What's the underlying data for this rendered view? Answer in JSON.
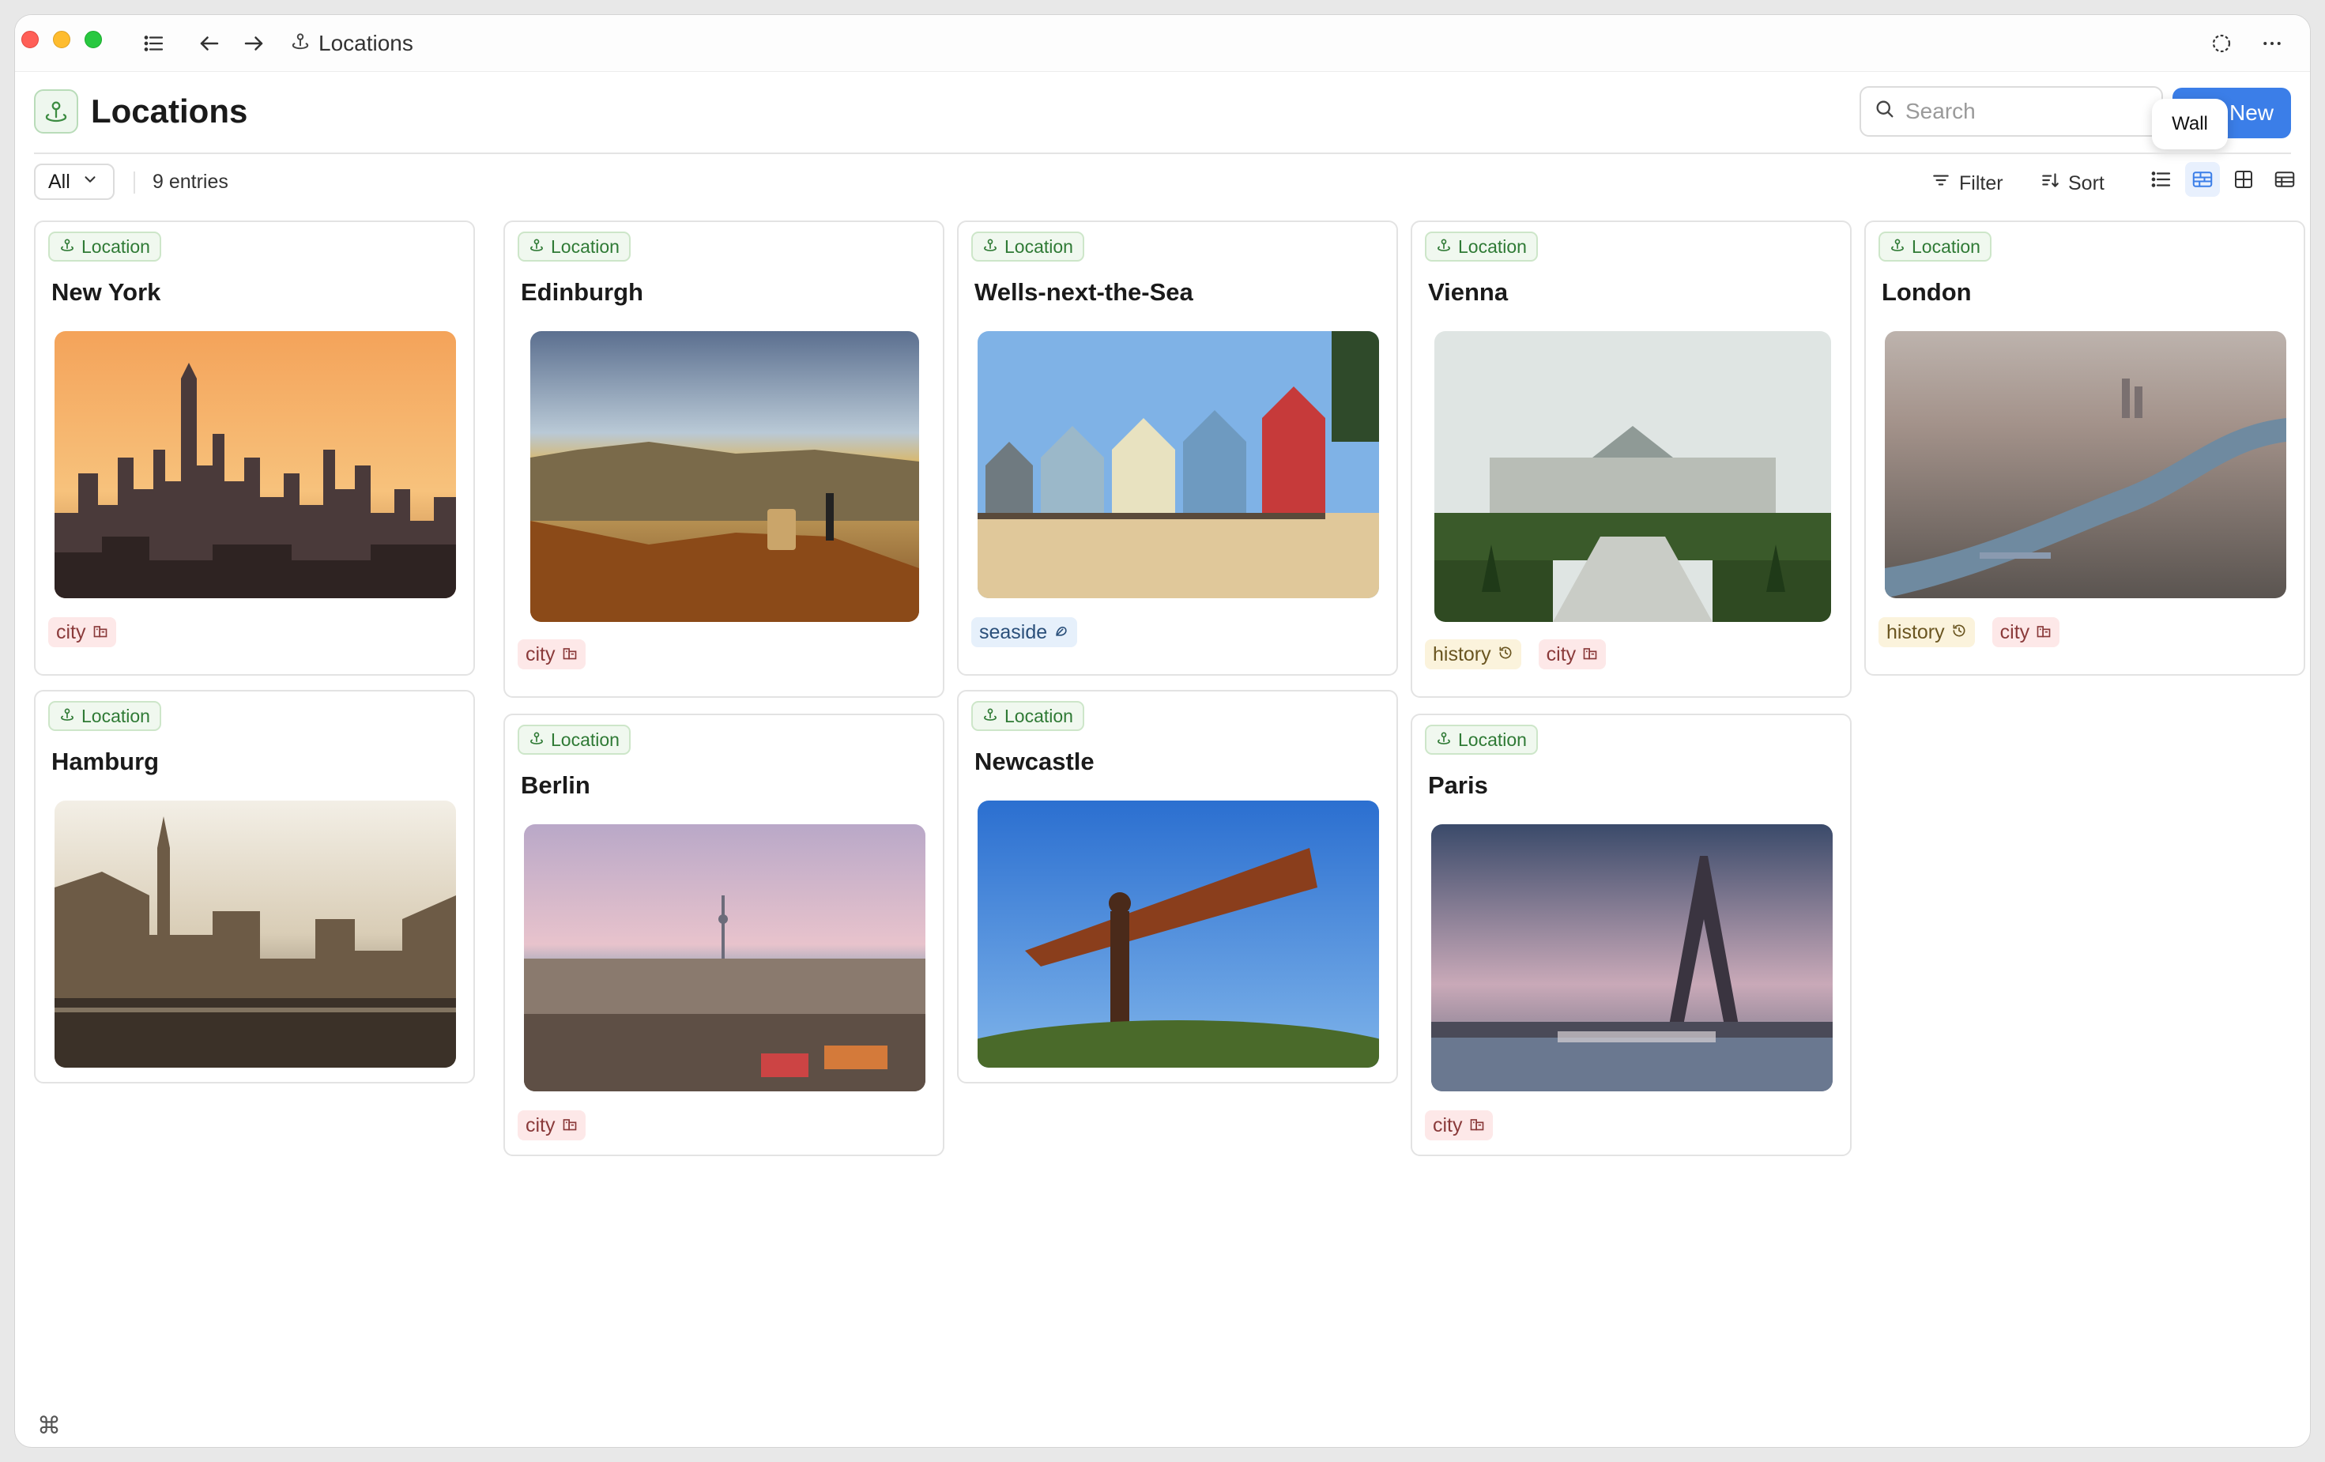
{
  "window": {
    "breadcrumb": "Locations"
  },
  "header": {
    "title": "Locations",
    "search_placeholder": "Search",
    "new_label": "New",
    "tooltip": "Wall"
  },
  "toolbar": {
    "filter_value": "All",
    "entries": "9 entries",
    "filter_label": "Filter",
    "sort_label": "Sort",
    "views": [
      "list-view-icon",
      "wall-view-icon",
      "grid-view-icon",
      "table-view-icon"
    ],
    "active_view": "Wall"
  },
  "colors": {
    "accent": "#3b7ee8",
    "type_badge": "#2f7a35",
    "tag_city": "#fde8e8",
    "tag_history": "#fbf3dc",
    "tag_seaside": "#e6f0fb"
  },
  "cards": [
    {
      "type": "Location",
      "title": "New York",
      "tags": [
        "city"
      ]
    },
    {
      "type": "Location",
      "title": "Edinburgh",
      "tags": [
        "city"
      ]
    },
    {
      "type": "Location",
      "title": "Wells-next-the-Sea",
      "tags": [
        "seaside"
      ]
    },
    {
      "type": "Location",
      "title": "Vienna",
      "tags": [
        "history",
        "city"
      ]
    },
    {
      "type": "Location",
      "title": "London",
      "tags": [
        "history",
        "city"
      ]
    },
    {
      "type": "Location",
      "title": "Hamburg",
      "tags": []
    },
    {
      "type": "Location",
      "title": "Berlin",
      "tags": [
        "city"
      ]
    },
    {
      "type": "Location",
      "title": "Newcastle",
      "tags": []
    },
    {
      "type": "Location",
      "title": "Paris",
      "tags": [
        "city"
      ]
    }
  ],
  "footer": {
    "shortcut": "⌘"
  }
}
